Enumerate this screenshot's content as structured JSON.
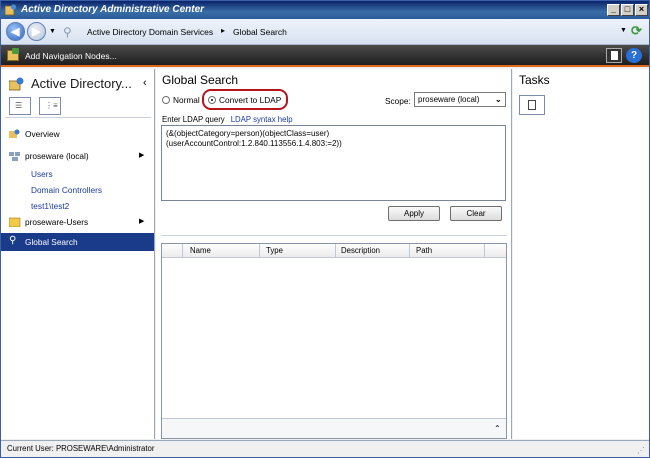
{
  "window": {
    "title": "Active Directory Administrative Center"
  },
  "address": {
    "crumbs": [
      "Active Directory Domain Services",
      "Global Search"
    ],
    "separator": "▸"
  },
  "navbar": {
    "add_nodes_label": "Add Navigation Nodes..."
  },
  "left": {
    "title": "Active Directory...",
    "tree": {
      "overview": "Overview",
      "proseware": "proseware (local)",
      "users": "Users",
      "domain_controllers": "Domain Controllers",
      "test": "test1\\test2",
      "proseware_users": "proseware-Users",
      "global_search": "Global Search"
    }
  },
  "main": {
    "title": "Global Search",
    "radio_normal": "Normal",
    "radio_ldap": "Convert to LDAP",
    "scope_label": "Scope:",
    "scope_value": "proseware (local)",
    "enter_query": "Enter LDAP query",
    "syntax_help": "LDAP syntax help",
    "query_line1": "(&(objectCategory=person)(objectClass=user)",
    "query_line2": "(userAccountControl:1.2.840.113556.1.4.803:=2))",
    "apply_label": "Apply",
    "clear_label": "Clear",
    "columns": [
      "Name",
      "Type",
      "Description",
      "Path"
    ]
  },
  "tasks": {
    "title": "Tasks"
  },
  "status": {
    "text": "Current User: PROSEWARE\\Administrator"
  },
  "colors": {
    "selection": "#1a3a8a",
    "highlight": "#b8141c",
    "navbar_accent": "#e06a1a"
  }
}
